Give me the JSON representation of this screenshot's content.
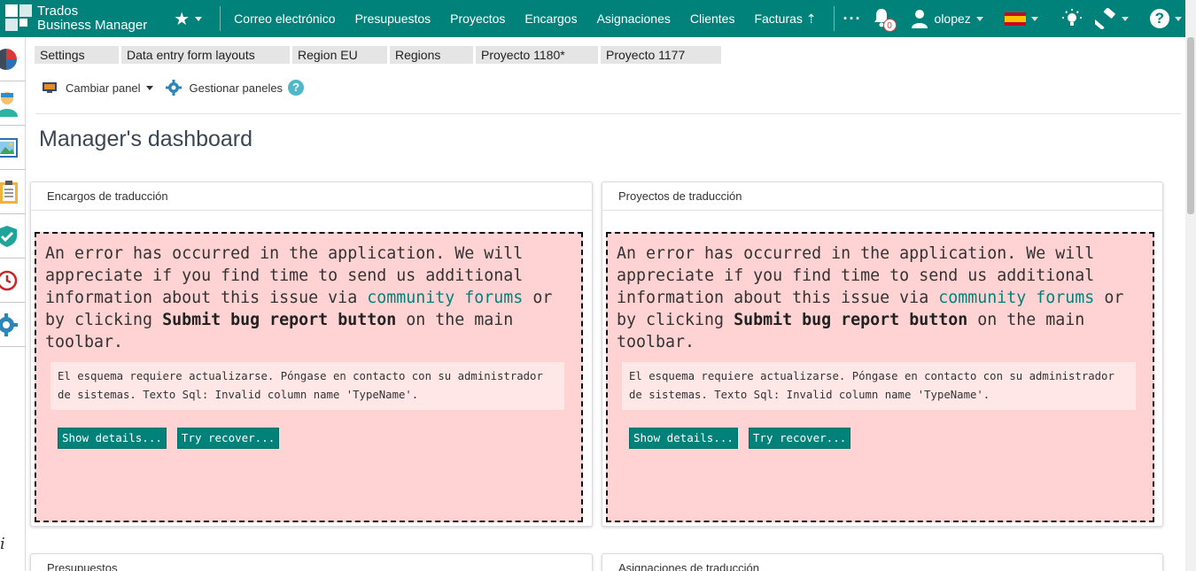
{
  "app": {
    "brand_line1": "Trados",
    "brand_line2": "Business Manager"
  },
  "nav": [
    "Correo electrónico",
    "Presupuestos",
    "Proyectos",
    "Encargos",
    "Asignaciones",
    "Clientes",
    "Facturas ⇡"
  ],
  "topbar": {
    "more": "···",
    "notifications_count": "0",
    "username": "olopez",
    "language": "es"
  },
  "tabs": [
    "Settings",
    "Data entry form layouts",
    "Region EU",
    "Regions",
    "Proyecto 1180*",
    "Proyecto 1177"
  ],
  "toolbar": {
    "switch_panel": "Cambiar panel",
    "manage_panels": "Gestionar paneles",
    "help": "?"
  },
  "page": {
    "title": "Manager's dashboard"
  },
  "panels": [
    {
      "title": "Encargos de traducción",
      "error": {
        "msg_part1": "An error has occurred in the application. We will appreciate if you find time to send us additional information about this issue via ",
        "link": "community forums",
        "msg_part2": " or by clicking ",
        "bold": "Submit bug report button",
        "msg_part3": " on the main toolbar.",
        "detail": "El esquema requiere actualizarse. Póngase en contacto con su administrador de sistemas. Texto Sql: Invalid column name 'TypeName'.",
        "show_details": "Show details...",
        "try_recover": "Try recover..."
      }
    },
    {
      "title": "Proyectos de traducción",
      "error": {
        "msg_part1": "An error has occurred in the application. We will appreciate if you find time to send us additional information about this issue via ",
        "link": "community forums",
        "msg_part2": " or by clicking ",
        "bold": "Submit bug report button",
        "msg_part3": " on the main toolbar.",
        "detail": "El esquema requiere actualizarse. Póngase en contacto con su administrador de sistemas. Texto Sql: Invalid column name 'TypeName'.",
        "show_details": "Show details...",
        "try_recover": "Try recover..."
      }
    },
    {
      "title": "Presupuestos"
    },
    {
      "title": "Asignaciones de traducción"
    }
  ],
  "sidebar": {
    "items": [
      "pie-chart-icon",
      "user-icon",
      "picture-icon",
      "clipboard-icon",
      "shield-check-icon",
      "clock-icon",
      "gear-icon"
    ],
    "info": "i"
  },
  "colors": {
    "accent": "#00827b",
    "error_bg": "#ffd3d3",
    "detail_bg": "#ffe7e7"
  }
}
